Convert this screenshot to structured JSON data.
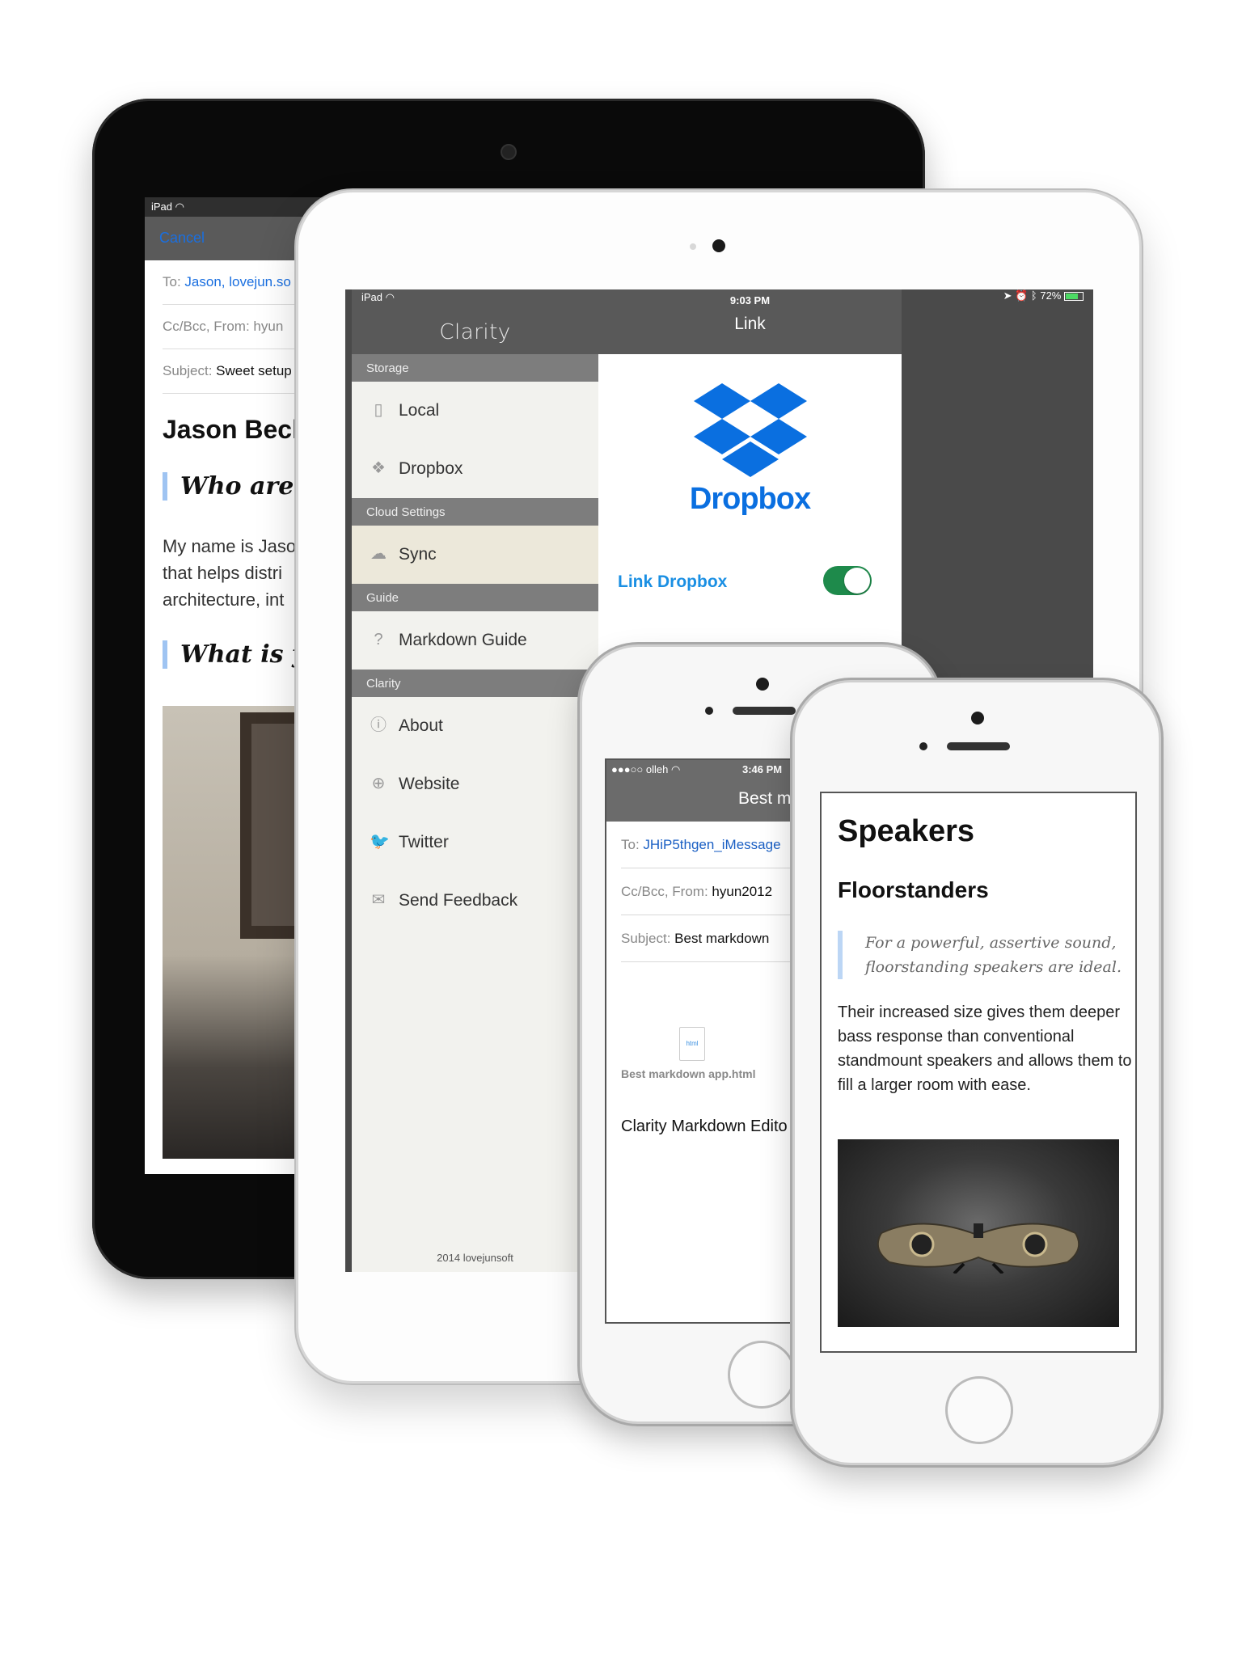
{
  "ipad_back": {
    "status": "iPad",
    "cancel": "Cancel",
    "to_label": "To:",
    "to_value": "Jason, lovejun.so",
    "ccbcc": "Cc/Bcc, From:",
    "from_value": "hyun",
    "subject_label": "Subject:",
    "subject_value": "Sweet setup",
    "heading": "Jason Beck",
    "quote1": "Who are yo",
    "para": [
      "My name is Jaso",
      "that helps distri",
      "architecture, int"
    ],
    "quote2": "What is yo"
  },
  "ipad_front": {
    "status_device": "iPad",
    "status_time": "9:03 PM",
    "status_battery": "72%",
    "sidebar_title": "Clarity",
    "sections": [
      {
        "title": "Storage",
        "items": [
          {
            "label": "Local",
            "icon": "phone-icon"
          },
          {
            "label": "Dropbox",
            "icon": "dropbox-icon"
          }
        ]
      },
      {
        "title": "Cloud Settings",
        "items": [
          {
            "label": "Sync",
            "icon": "cloud-sync-icon"
          }
        ]
      },
      {
        "title": "Guide",
        "items": [
          {
            "label": "Markdown Guide",
            "icon": "help-icon"
          }
        ]
      },
      {
        "title": "Clarity",
        "items": [
          {
            "label": "About",
            "icon": "info-icon"
          },
          {
            "label": "Website",
            "icon": "globe-icon"
          },
          {
            "label": "Twitter",
            "icon": "twitter-icon"
          },
          {
            "label": "Send Feedback",
            "icon": "mail-icon"
          }
        ]
      }
    ],
    "footer": "2014 lovejunsoft",
    "link_title": "Link",
    "dropbox_word": "Dropbox",
    "link_label": "Link Dropbox",
    "link_enabled": true
  },
  "iphone_mid": {
    "carrier": "●●●○○ olleh",
    "time": "3:46 PM",
    "nav_title": "Best markdo",
    "to_label": "To:",
    "to_value": "JHiP5thgen_iMessage",
    "ccbcc": "Cc/Bcc, From:",
    "from_value": "hyun2012",
    "subject_label": "Subject:",
    "subject_value": "Best markdown",
    "attachment_icon": "html",
    "attachment_name": "Best markdown app.html",
    "body": "Clarity Markdown Edito"
  },
  "iphone_front": {
    "h1": "Speakers",
    "h2": "Floorstanders",
    "quote": "For a powerful, assertive sound, floorstanding speakers are ideal.",
    "paragraph": "Their increased size gives them deeper bass response than conventional standmount speakers and allows them to fill a larger room with ease."
  },
  "colors": {
    "accent_blue": "#1a8fe3",
    "dropbox_blue": "#0a6fe0",
    "toggle_on": "#1e8a4b"
  }
}
